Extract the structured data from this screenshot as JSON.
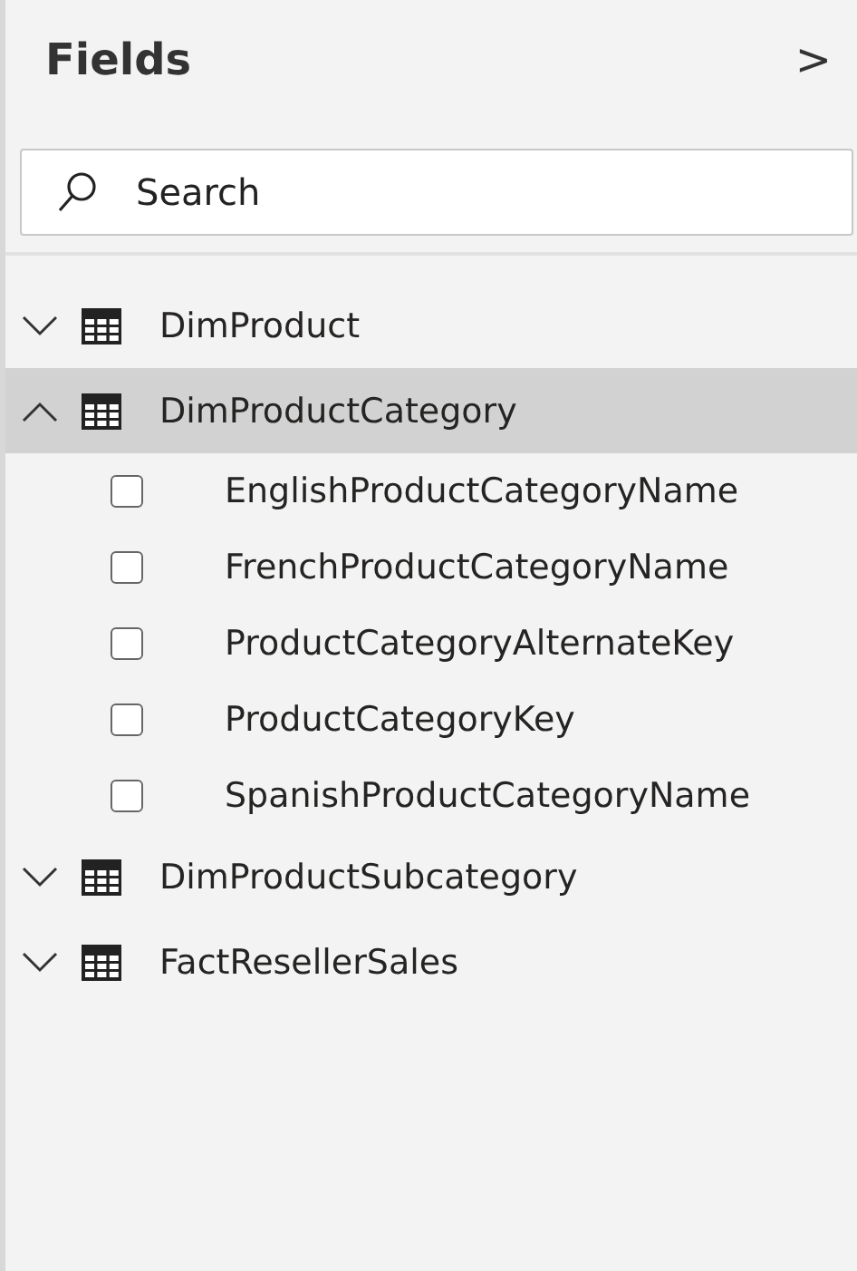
{
  "panel": {
    "title": "Fields",
    "collapse_glyph": ">"
  },
  "search": {
    "placeholder": "Search"
  },
  "tables": [
    {
      "name": "DimProduct",
      "expanded": false,
      "selected": false
    },
    {
      "name": "DimProductCategory",
      "expanded": true,
      "selected": true,
      "fields": [
        {
          "name": "EnglishProductCategoryName",
          "checked": false
        },
        {
          "name": "FrenchProductCategoryName",
          "checked": false
        },
        {
          "name": "ProductCategoryAlternateKey",
          "checked": false
        },
        {
          "name": "ProductCategoryKey",
          "checked": false
        },
        {
          "name": "SpanishProductCategoryName",
          "checked": false
        }
      ]
    },
    {
      "name": "DimProductSubcategory",
      "expanded": false,
      "selected": false
    },
    {
      "name": "FactResellerSales",
      "expanded": false,
      "selected": false
    }
  ]
}
